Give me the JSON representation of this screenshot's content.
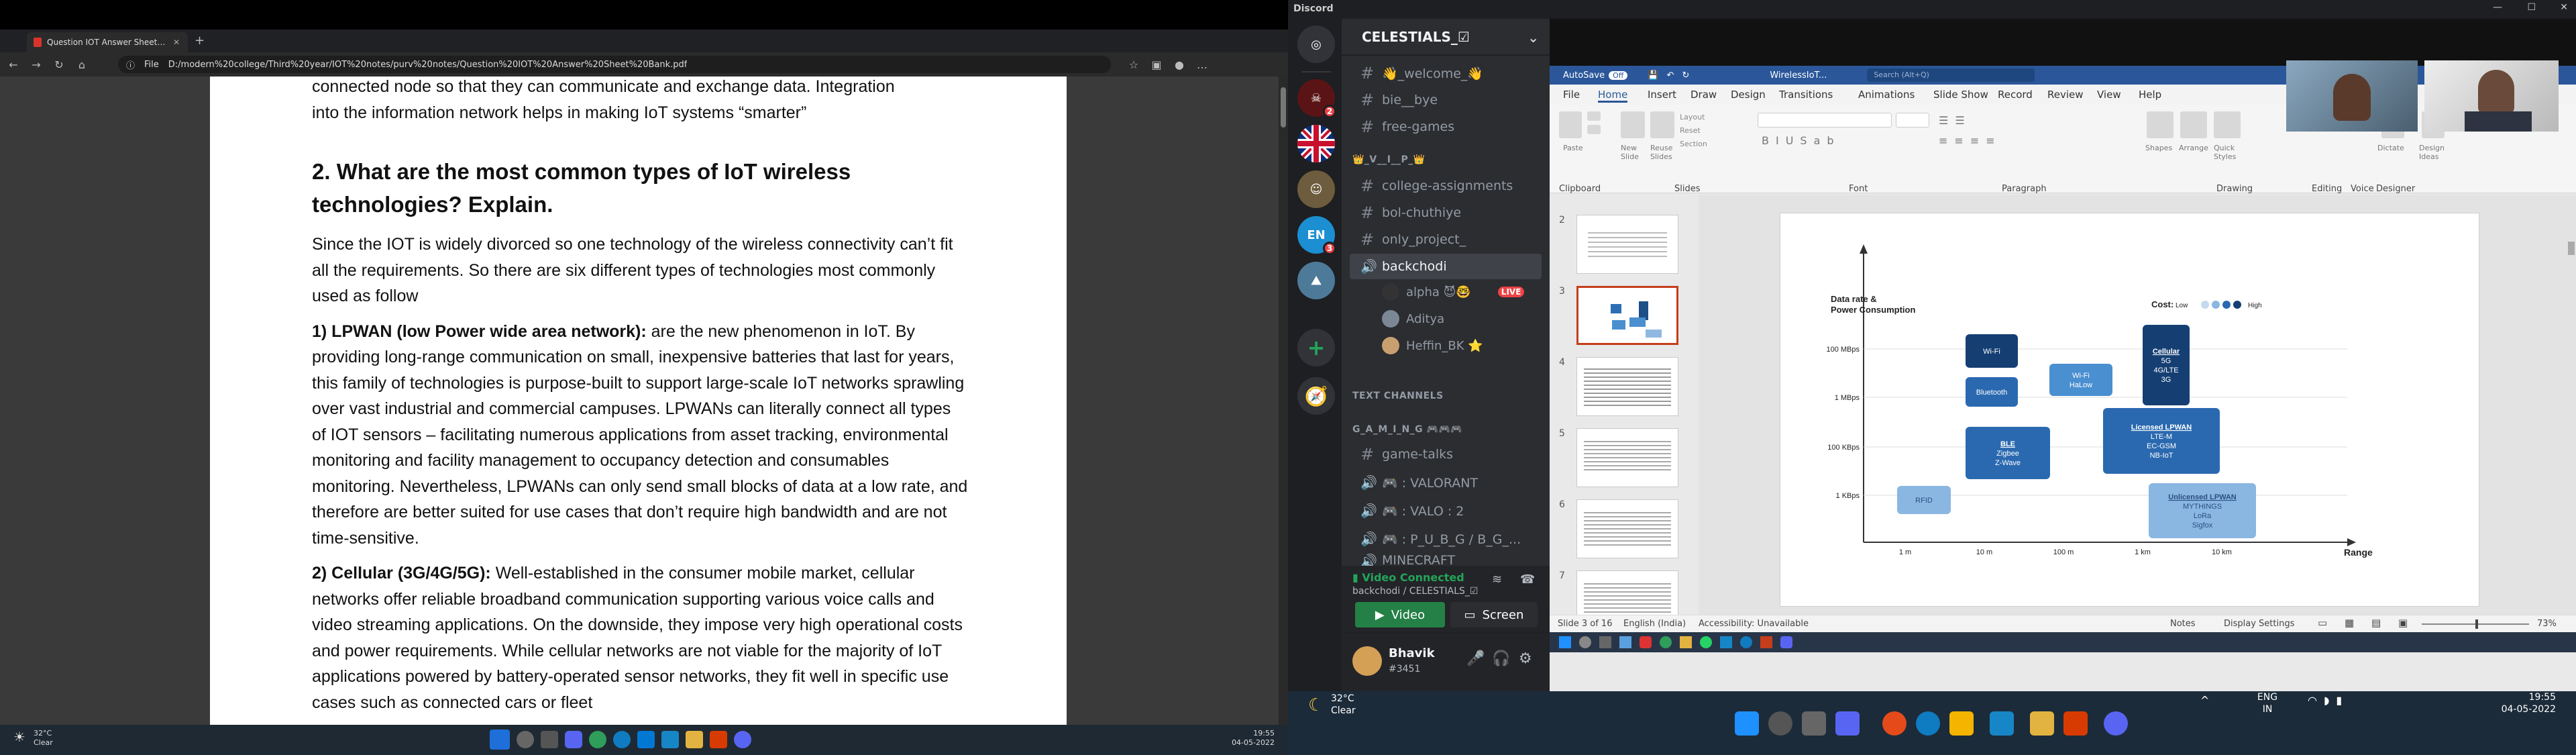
{
  "edge": {
    "tab_title": "Question IOT Answer Sheet Bank.pdf",
    "file_label": "File",
    "url": "D:/modern%20college/Third%20year/IOT%20notes/purv%20notes/Question%20IOT%20Answer%20Sheet%20Bank.pdf",
    "pdf_top_lines": [
      "connected node so that they can communicate and exchange data. Integration",
      "into the information network helps in making IoT systems “smarter”"
    ],
    "heading": "2. What are the most common types of IoT wireless technologies? Explain.",
    "intro": "Since the IOT is widely divorced so one technology of the wireless connectivity can’t fit all the requirements. So there are six different types of technologies most commonly used as follow",
    "lpwan_title": "1) LPWAN (low Power wide area network):",
    "lpwan_body": "are the new phenomenon in IoT. By providing long-range communication on small, inexpensive batteries that last for years, this family of technologies is purpose-built to support large-scale IoT networks sprawling over vast industrial and commercial campuses. LPWANs can literally connect all types of IOT sensors – facilitating numerous applications from asset tracking, environmental monitoring and facility management to occupancy detection and consumables monitoring. Nevertheless, LPWANs can only send small blocks of data at a low rate, and therefore are better suited for use cases that don’t require high bandwidth and are not time-sensitive.",
    "cellular_title": "2) Cellular (3G/4G/5G):",
    "cellular_body": "Well-established in the consumer mobile market, cellular networks offer reliable broadband communication supporting various voice calls and video streaming applications. On the downside, they impose very high operational costs and power requirements. While cellular networks are not viable for the majority of IoT applications powered by battery-operated sensor networks, they fit well in specific use cases such as connected cars or fleet",
    "weather_temp": "32°C",
    "weather_desc": "Clear",
    "clock_time": "19:55",
    "clock_date": "04-05-2022"
  },
  "window_title": "Discord",
  "discord": {
    "server_name": "CELESTIALS_☑",
    "channels": [
      {
        "name": "👋_welcome_👋",
        "type": "text"
      },
      {
        "name": "bie__bye",
        "type": "text"
      },
      {
        "name": "free-games",
        "type": "text"
      }
    ],
    "vip_category": "👑_V__I__P_👑",
    "vip_channels": [
      {
        "name": "college-assignments"
      },
      {
        "name": "bol-chuthiye"
      },
      {
        "name": "only_project_"
      }
    ],
    "voice_channel": "backchodi",
    "voice_users": [
      {
        "name": "alpha 😈🤓",
        "live": "LIVE"
      },
      {
        "name": "Aditya"
      },
      {
        "name": "Heffin_BK ⭐"
      }
    ],
    "text_channels_category": "TEXT CHANNELS",
    "gaming_category": "G_A_M_I_N_G 🎮🎮🎮",
    "gaming_channels": [
      {
        "name": "game-talks",
        "type": "text"
      },
      {
        "name": "🎮 : VALORANT",
        "type": "voice"
      },
      {
        "name": "🎮 : VALO : 2",
        "type": "voice"
      },
      {
        "name": "🎮 : P_U_B_G / B_G_...",
        "type": "voice"
      }
    ],
    "partial_channel": "MINECRAFT",
    "voice_status": "Video Connected",
    "voice_location": "backchodi / CELESTIALS_☑",
    "video_button": "Video",
    "screen_button": "Screen",
    "username": "Bhavik",
    "tag": "#3451",
    "guild_badges": [
      "2",
      "3"
    ],
    "guild_labels": [
      "EN"
    ]
  },
  "powerpoint": {
    "autosave_label": "AutoSave",
    "autosave_state": "Off",
    "file_name": "WirelessIoT...",
    "search_placeholder": "Search (Alt+Q)",
    "tabs": [
      "File",
      "Home",
      "Insert",
      "Draw",
      "Design",
      "Transitions",
      "Animations",
      "Slide Show",
      "Record",
      "Review",
      "View",
      "Help"
    ],
    "active_tab": "Home",
    "groups": [
      "Clipboard",
      "Slides",
      "Font",
      "Paragraph",
      "Drawing",
      "Editing",
      "Voice",
      "Designer"
    ],
    "ribbon_small": [
      "Paste",
      "New Slide",
      "Reuse Slides",
      "Layout",
      "Reset",
      "Section",
      "Shapes",
      "Arrange",
      "Quick Styles",
      "Dictate",
      "Design Ideas"
    ],
    "thumb_numbers": [
      "2",
      "3",
      "4",
      "5",
      "6",
      "7"
    ],
    "slide_status": "Slide 3 of 16",
    "language": "English (India)",
    "accessibility": "Accessibility: Unavailable",
    "notes": "Notes",
    "display_settings": "Display Settings",
    "zoom": "73%"
  },
  "chart_data": {
    "type": "diagram",
    "ylabel": "Data rate & Power Consumption",
    "xlabel": "Range",
    "y_ticks": [
      "100 MBps",
      "1 MBps",
      "100 KBps",
      "1 KBps"
    ],
    "x_ticks": [
      "1 m",
      "10 m",
      "100 m",
      "1 km",
      "10 km"
    ],
    "cost_label": "Cost:",
    "cost_low": "Low",
    "cost_high": "High",
    "boxes": [
      {
        "label": "Wi-Fi",
        "cost": 4
      },
      {
        "label": "Bluetooth",
        "cost": 3
      },
      {
        "label": "Wi-Fi HaLow",
        "cost": 2
      },
      {
        "label": "Cellular 5G 4G/LTE 3G",
        "cost": 4
      },
      {
        "label": "BLE Zigbee Z-Wave",
        "cost": 3
      },
      {
        "label": "Licensed LPWAN LTE-M EC-GSM NB-IoT",
        "cost": 3
      },
      {
        "label": "RFID",
        "cost": 1
      },
      {
        "label": "Unlicensed LPWAN MYTHINGS LoRa Sigfox",
        "cost": 1
      }
    ]
  },
  "tray": {
    "weather_temp": "32°C",
    "weather_desc": "Clear",
    "lang_line1": "ENG",
    "lang_line2": "IN",
    "time": "19:55",
    "date": "04-05-2022"
  }
}
